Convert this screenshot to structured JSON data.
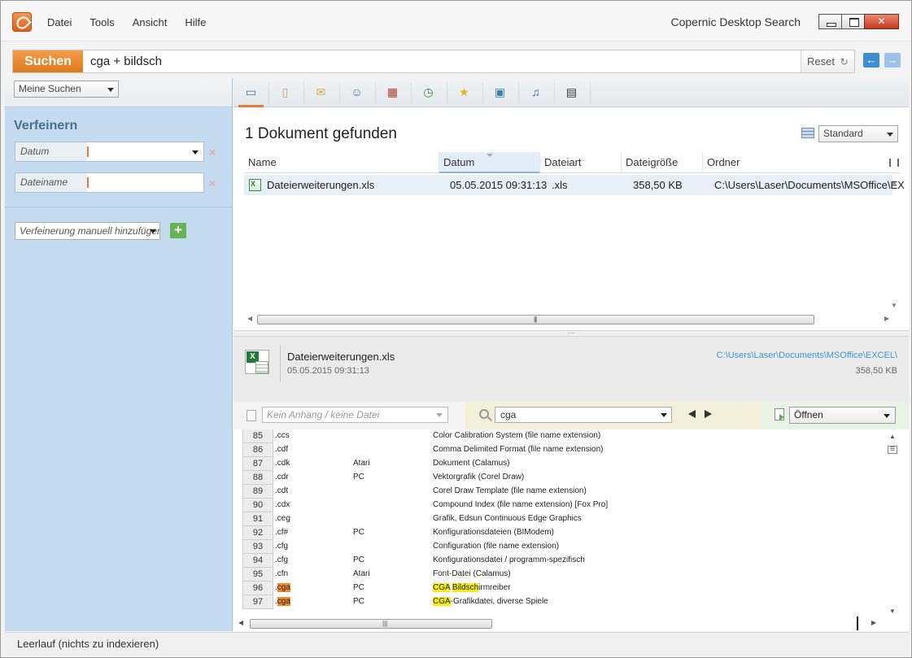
{
  "menu": [
    "Datei",
    "Tools",
    "Ansicht",
    "Hilfe"
  ],
  "app_title": "Copernic Desktop Search",
  "search": {
    "button": "Suchen",
    "query": "cga + bildsch",
    "reset": "Reset"
  },
  "left": {
    "my_searches": "Meine Suchen",
    "refine_title": "Verfeinern",
    "filters": [
      {
        "label": "Datum",
        "value": ""
      },
      {
        "label": "Dateiname",
        "value": ""
      }
    ],
    "add_refinement": "Verfeinerung manuell hinzufügen"
  },
  "category_tabs": [
    "computer-icon",
    "document-icon",
    "email-icon",
    "contact-icon",
    "calendar-icon",
    "history-icon",
    "favorite-icon",
    "image-icon",
    "music-icon",
    "video-icon"
  ],
  "results": {
    "title": "1 Dokument gefunden",
    "view_select": "Standard",
    "columns": [
      "Name",
      "Datum",
      "Dateiart",
      "Dateigröße",
      "Ordner"
    ],
    "rows": [
      {
        "name": "Dateierweiterungen.xls",
        "date": "05.05.2015 09:31:13",
        "type": ".xls",
        "size": "358,50 KB",
        "folder": "C:\\Users\\Laser\\Documents\\MSOffice\\EX"
      }
    ]
  },
  "preview": {
    "name": "Dateierweiterungen.xls",
    "date": "05.05.2015 09:31:13",
    "path": "C:\\Users\\Laser\\Documents\\MSOffice\\EXCEL\\",
    "size": "358,50 KB",
    "attachment": "Kein Anhang / keine Datei",
    "find": "cga",
    "open": "Öffnen"
  },
  "sheet_rows": [
    {
      "n": "85",
      "ext": ".ccs",
      "plat": "",
      "desc": "Color Calibration System (file name extension)"
    },
    {
      "n": "86",
      "ext": ".cdf",
      "plat": "",
      "desc": "Comma Delimited Format (file name extension)"
    },
    {
      "n": "87",
      "ext": ".cdk",
      "plat": "Atari",
      "desc": "Dokument (Calamus)"
    },
    {
      "n": "88",
      "ext": ".cdr",
      "plat": "PC",
      "desc": "Vektorgrafik (Corel Draw)"
    },
    {
      "n": "89",
      "ext": ".cdt",
      "plat": "",
      "desc": "Corel Draw Template (file name extension)"
    },
    {
      "n": "90",
      "ext": ".cdx",
      "plat": "",
      "desc": "Compound Index (file name extension) [Fox Pro]"
    },
    {
      "n": "91",
      "ext": ".ceg",
      "plat": "",
      "desc": "Grafik, Edsun Continuous Edge Graphics"
    },
    {
      "n": "92",
      "ext": ".cf#",
      "plat": "PC",
      "desc": "Konfigurationsdateien (BIModem)"
    },
    {
      "n": "93",
      "ext": ".cfg",
      "plat": "",
      "desc": "Configuration (file name extension)"
    },
    {
      "n": "94",
      "ext": ".cfg",
      "plat": "PC",
      "desc": "Konfigurationsdatei / programm-spezifisch"
    },
    {
      "n": "95",
      "ext": ".cfn",
      "plat": "Atari",
      "desc": "Font-Datei (Calamus)"
    },
    {
      "n": "96",
      "ext_pre": ".",
      "ext_hl": "cga",
      "plat": "PC",
      "desc_hl1": "CGA",
      "desc_mid": " ",
      "desc_hl2": "Bildsch",
      "desc_post": "irmreiber"
    },
    {
      "n": "97",
      "ext_pre": ".",
      "ext_hl": "cga",
      "plat": "PC",
      "desc_hl1": "CGA",
      "desc_post": "-Grafikdatei, diverse Spiele"
    }
  ],
  "status": "Leerlauf (nichts zu indexieren)"
}
